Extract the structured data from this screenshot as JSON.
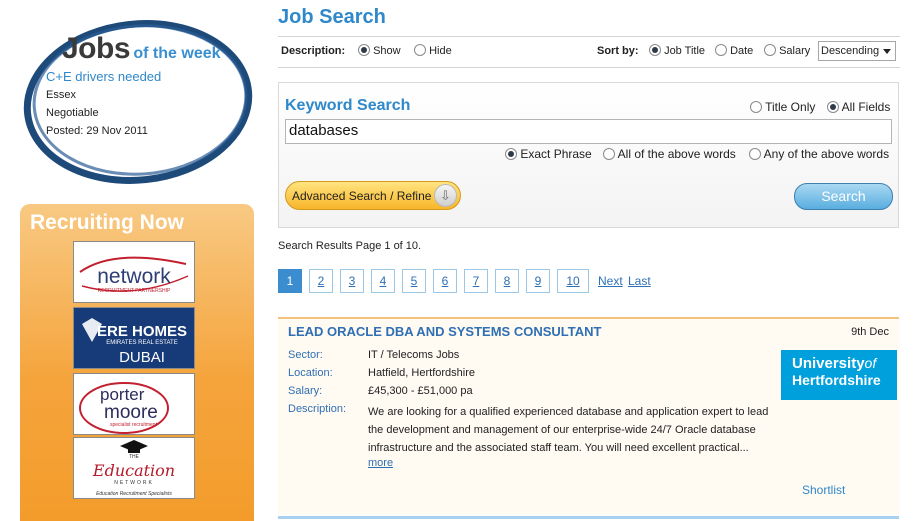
{
  "sidebar": {
    "jobs_of_week": {
      "title_big": "Jobs",
      "title_small": "of the week",
      "job_title": "C+E drivers needed",
      "location": "Essex",
      "salary": "Negotiable",
      "posted": "Posted: 29 Nov 2011"
    },
    "recruiting": {
      "title": "Recruiting Now",
      "logos": [
        {
          "name": "network",
          "line1": "network",
          "line2": "RECRUITMENT PARTNERSHIP"
        },
        {
          "name": "ere-homes",
          "line1": "ERE HOMES",
          "line2": "EMIRATES REAL ESTATE",
          "line3": "DUBAI"
        },
        {
          "name": "porter-moore",
          "line1": "porter",
          "line2": "moore",
          "line3": "specialist recruitment"
        },
        {
          "name": "education-network",
          "line1": "THE",
          "line2": "Education",
          "line3": "NETWORK",
          "line4": "Education Recruitment Specialists"
        }
      ]
    }
  },
  "main": {
    "title": "Job Search",
    "options": {
      "description_label": "Description:",
      "show_label": "Show",
      "hide_label": "Hide",
      "sort_label": "Sort by:",
      "sort_job_title": "Job Title",
      "sort_date": "Date",
      "sort_salary": "Salary",
      "order_value": "Descending"
    },
    "keyword": {
      "title": "Keyword Search",
      "title_only": "Title Only",
      "all_fields": "All Fields",
      "input_value": "databases",
      "exact_phrase": "Exact Phrase",
      "all_words": "All of the above words",
      "any_words": "Any of the above words",
      "advanced_label": "Advanced Search / Refine",
      "search_label": "Search"
    },
    "results_info": "Search Results Page 1 of 10.",
    "pager": {
      "pages": [
        "1",
        "2",
        "3",
        "4",
        "5",
        "6",
        "7",
        "8",
        "9",
        "10"
      ],
      "current": "1",
      "next_label": "Next",
      "last_label": "Last"
    },
    "job": {
      "title": "LEAD ORACLE DBA AND SYSTEMS CONSULTANT",
      "date": "9th Dec",
      "sector_label": "Sector:",
      "sector": "IT / Telecoms Jobs",
      "location_label": "Location:",
      "location": "Hatfield, Hertfordshire",
      "salary_label": "Salary:",
      "salary": "£45,300 - £51,000 pa",
      "description_label": "Description:",
      "description": "We are looking for a qualified experienced database and application expert to lead the development and management of our enterprise-wide 24/7 Oracle database infrastructure and the associated staff team. You will need excellent practical...",
      "more_label": "more",
      "shortlist_label": "Shortlist",
      "employer_logo_line1": "University",
      "employer_logo_of": "of",
      "employer_logo_line2": "Hertfordshire"
    }
  },
  "colors": {
    "accent": "#2f88c9",
    "link": "#2f6fb3",
    "orange": "#f5a43c",
    "ring": "#1e4a7a"
  }
}
